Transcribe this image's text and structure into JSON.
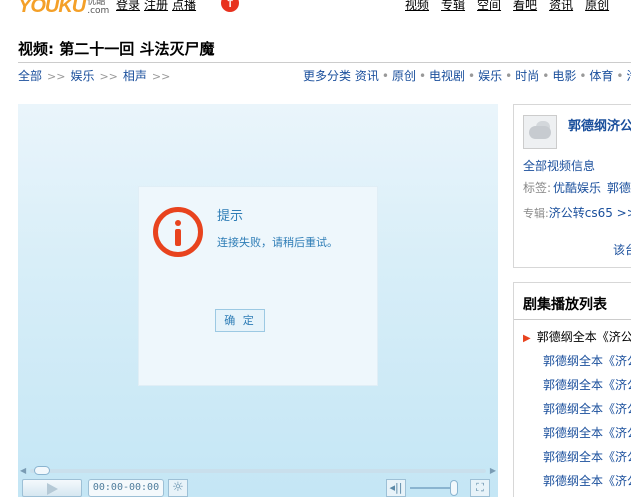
{
  "header": {
    "logo_main": "YOUKU",
    "logo_cn": "优酷",
    "logo_domain": ".com",
    "login": "登录",
    "register": "注册",
    "ondemand": "点播",
    "nav": [
      "视频",
      "专辑",
      "空间",
      "看吧",
      "资讯",
      "原创"
    ]
  },
  "title": "视频: 第二十一回  斗法灭尸魔",
  "breadcrumb": [
    "全部",
    "娱乐",
    "相声"
  ],
  "breadcrumb_sep": ">>",
  "categories": {
    "label": "更多分类",
    "items": [
      "资讯",
      "原创",
      "电视剧",
      "娱乐",
      "时尚",
      "电影",
      "体育",
      "汽"
    ]
  },
  "dialog": {
    "title": "提示",
    "message": "连接失败，请稍后重试。",
    "ok_label": "确 定"
  },
  "player": {
    "time": "00:00-00:00",
    "brightness_icon": "☼",
    "volume_icon": "◂||",
    "fullscreen_icon": "⛶"
  },
  "info": {
    "channel": "郭德纲济公",
    "all_info": "全部视频信息",
    "tags_label": "标签:",
    "tags": [
      "优酷娱乐",
      "郭德"
    ],
    "album_label": "专辑:",
    "album": "济公转cs65 >>",
    "more": "该台"
  },
  "playlist": {
    "title": "剧集播放列表",
    "items": [
      "郭德纲全本《济公",
      "郭德纲全本《济公",
      "郭德纲全本《济公",
      "郭德纲全本《济公",
      "郭德纲全本《济公",
      "郭德纲全本《济公",
      "郭德纲全本《济公"
    ]
  },
  "colors": {
    "link": "#1a4f9c",
    "alert": "#e8431e",
    "dialog_text": "#2e7db6",
    "player_bg": "#c4e6f5"
  }
}
